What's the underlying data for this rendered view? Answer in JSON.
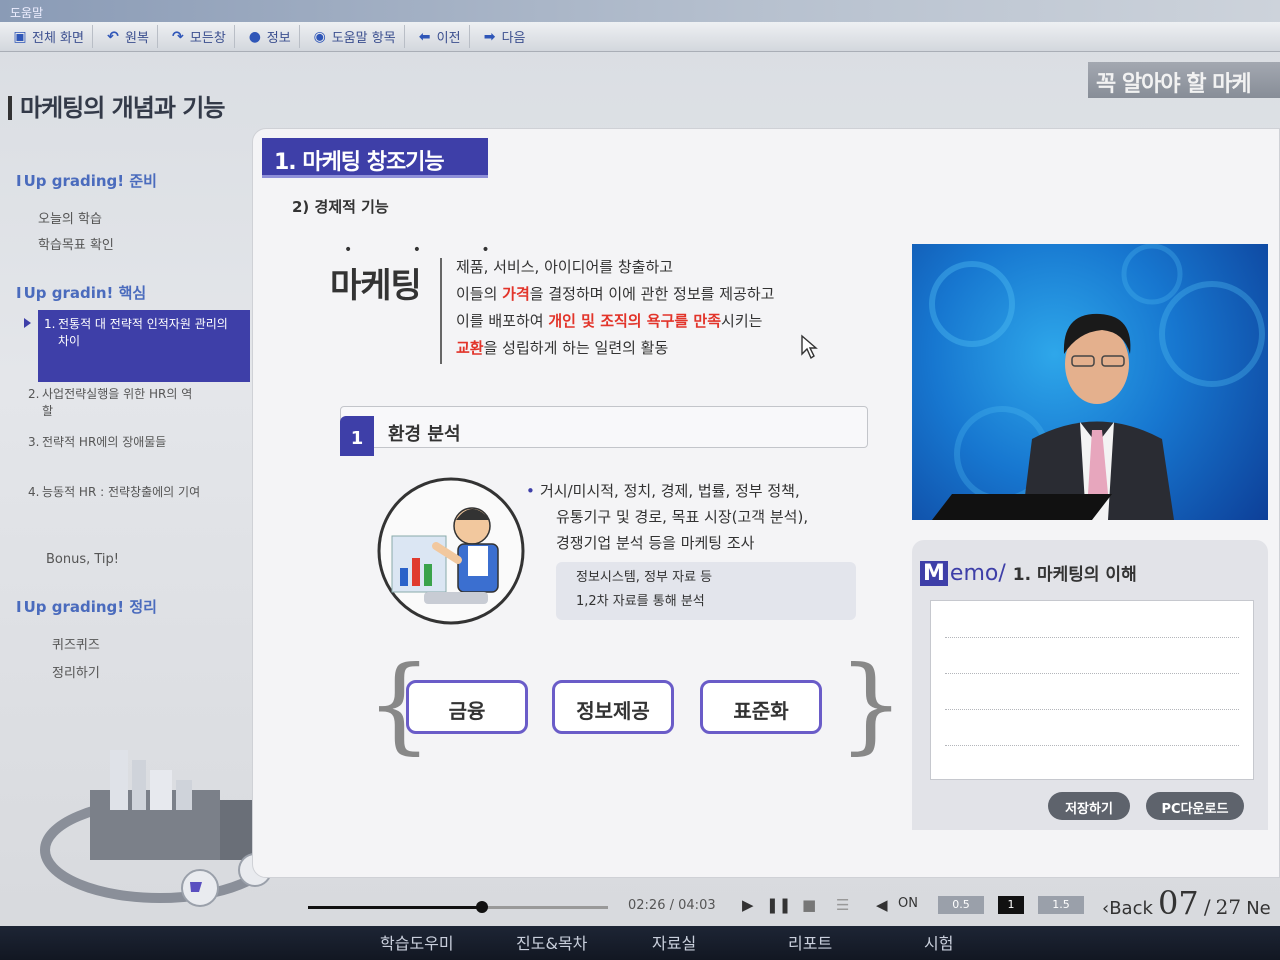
{
  "window": {
    "title": "도움말"
  },
  "toolbar": {
    "items": [
      {
        "label": "전체 화면"
      },
      {
        "label": "원복"
      },
      {
        "label": "모든창"
      },
      {
        "label": "정보"
      },
      {
        "label": "도움말 항목"
      },
      {
        "label": "이전"
      },
      {
        "label": "다음"
      }
    ]
  },
  "header": {
    "title": "마케팅의 개념과 기능",
    "badge": "꼭 알아야 할 마케"
  },
  "sidebar": {
    "sections": [
      {
        "label": "Up grading! 준비"
      },
      {
        "label": "Up gradin! 핵심"
      },
      {
        "label": "Up grading! 정리"
      }
    ],
    "prep_links": [
      "오늘의 학습",
      "학습목표 확인"
    ],
    "core_items": [
      {
        "num": "1.",
        "label": "전통적 대 전략적 인적자원 관리의 차이"
      },
      {
        "num": "2.",
        "label": "사업전략실행을 위한 HR의 역할"
      },
      {
        "num": "3.",
        "label": "전략적 HR에의 장애물들"
      },
      {
        "num": "4.",
        "label": "능동적 HR : 전략창출에의 기여"
      }
    ],
    "bonus": "Bonus, Tip!",
    "review_links": [
      "퀴즈퀴즈",
      "정리하기"
    ]
  },
  "content": {
    "section_tab": "1. 마케팅 창조기능",
    "subtitle": "2) 경제적 기능",
    "mk_word": "마케팅",
    "mk_dots": "• • •",
    "definition": {
      "line1": "제품, 서비스, 아이디어를 창출하고",
      "line2_a": "이들의 ",
      "line2_red": "가격",
      "line2_b": "을 결정하며 이에 관한 정보를 제공하고",
      "line3_a": "이를 배포하여 ",
      "line3_red": "개인 및 조직의 욕구를 만족",
      "line3_b": "시키는",
      "line4_red": "교환",
      "line4_b": "을 성립하게 하는 일련의 활동"
    },
    "env": {
      "num": "1",
      "title": "환경 분석",
      "bullet_dot": "•",
      "bullet_line1": "거시/미시적, 정치, 경제, 법률, 정부 정책,",
      "bullet_line2": "유통기구 및 경로, 목표 시장(고객 분석),",
      "bullet_line3": "경쟁기업 분석 등을 마케팅 조사",
      "info_line1": "정보시스템, 정부 자료 등",
      "info_line2": "1,2차 자료를 통해 분석"
    },
    "options": [
      "금융",
      "정보제공",
      "표준화"
    ]
  },
  "memo": {
    "m": "M",
    "label": "emo",
    "slash": "/ ",
    "subtitle": "1. 마케팅의 이해",
    "save_button": "저장하기",
    "download_button": "PC다운로드"
  },
  "player": {
    "progress": 0.58,
    "current_time": "02:26",
    "separator": "/",
    "total_time": "04:03",
    "sound": "ON",
    "speeds": [
      "0.5",
      "1",
      "1.5"
    ],
    "selected_speed": "1",
    "back_label": "Back",
    "page_current": "07",
    "page_separator": "/",
    "page_total": "27",
    "next_label": "Ne"
  },
  "bottom_nav": [
    "학습도우미",
    "진도&목차",
    "자료실",
    "리포트",
    "시험"
  ],
  "colors": {
    "accent": "#3e3fa8",
    "highlight": "#e2342a",
    "video_bg": "#1777d0"
  }
}
